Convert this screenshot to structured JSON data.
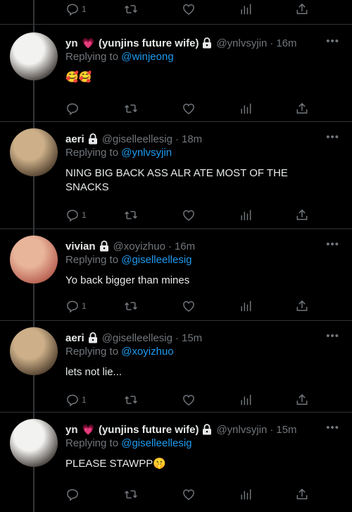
{
  "tweets": [
    {
      "name": "yn",
      "has_heart": true,
      "heart": "💗",
      "name_suffix": "(yunjins future wife)",
      "handle": "@ynlvsyjin",
      "time": "16m",
      "replying_label": "Replying to",
      "replying_to": "@winjeong",
      "text": "🥰🥰",
      "reply_count": "",
      "avatar_colors": [
        "#f2f2f0",
        "#3a3430"
      ]
    },
    {
      "name": "aeri",
      "has_heart": false,
      "heart": "",
      "name_suffix": "",
      "handle": "@giselleellesig",
      "time": "18m",
      "replying_label": "Replying to",
      "replying_to": "@ynlvsyjin",
      "text": "NING BIG BACK ASS ALR ATE MOST OF THE SNACKS",
      "reply_count": "1",
      "avatar_colors": [
        "#cdb089",
        "#4b3b2b"
      ]
    },
    {
      "name": "vivian",
      "has_heart": false,
      "heart": "",
      "name_suffix": "",
      "handle": "@xoyizhuo",
      "time": "16m",
      "replying_label": "Replying to",
      "replying_to": "@giselleellesig",
      "text": "Yo back bigger than mines",
      "reply_count": "1",
      "avatar_colors": [
        "#e8b49a",
        "#b45a4c"
      ]
    },
    {
      "name": "aeri",
      "has_heart": false,
      "heart": "",
      "name_suffix": "",
      "handle": "@giselleellesig",
      "time": "15m",
      "replying_label": "Replying to",
      "replying_to": "@xoyizhuo",
      "text": "lets not lie...",
      "reply_count": "1",
      "avatar_colors": [
        "#cdb089",
        "#4b3b2b"
      ]
    },
    {
      "name": "yn",
      "has_heart": true,
      "heart": "💗",
      "name_suffix": "(yunjins future wife)",
      "handle": "@ynlvsyjin",
      "time": "15m",
      "replying_label": "Replying to",
      "replying_to": "@giselleellesig",
      "text": "PLEASE STAWPP🤫",
      "reply_count": "",
      "avatar_colors": [
        "#f2f2f0",
        "#3a3430"
      ]
    }
  ],
  "top_actions": {
    "reply_count": "1"
  },
  "icons": [
    "reply-icon",
    "retweet-icon",
    "like-icon",
    "views-icon",
    "share-icon",
    "more-icon",
    "lock-icon"
  ],
  "colors": {
    "background": "#000000",
    "text": "#e7e9ea",
    "muted": "#71767b",
    "link": "#1d9bf0"
  }
}
